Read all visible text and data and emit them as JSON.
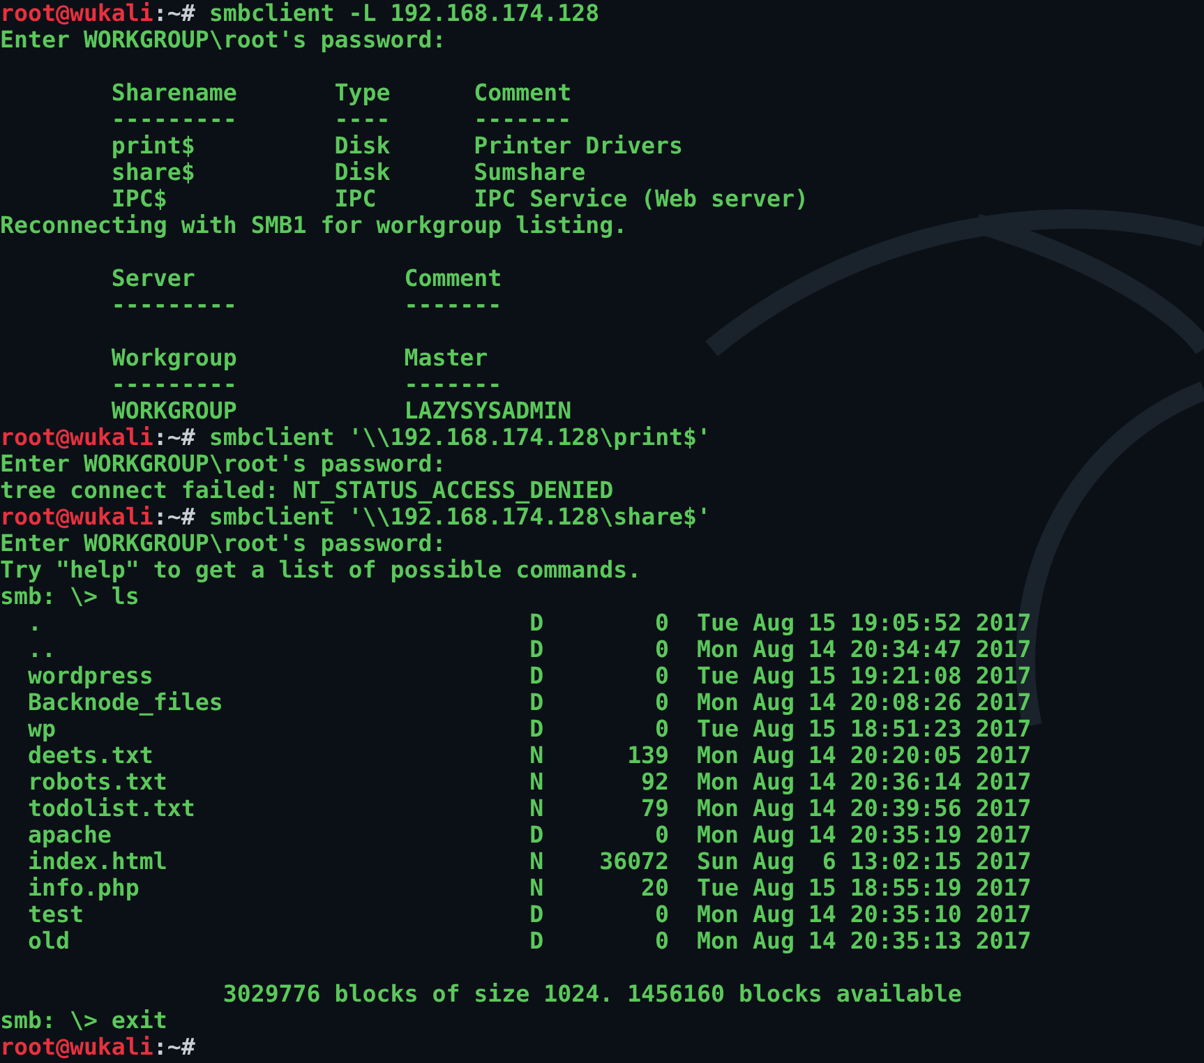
{
  "terminal": {
    "lines": [
      {
        "kind": "prompt",
        "user_host": "root@wukali",
        "path": ":~#",
        "command": "smbclient -L 192.168.174.128"
      },
      {
        "kind": "output",
        "text": "Enter WORKGROUP\\root's password:"
      },
      {
        "kind": "blank"
      },
      {
        "kind": "output",
        "text": "        Sharename       Type      Comment"
      },
      {
        "kind": "output",
        "text": "        ---------       ----      -------"
      },
      {
        "kind": "output",
        "text": "        print$          Disk      Printer Drivers"
      },
      {
        "kind": "output",
        "text": "        share$          Disk      Sumshare"
      },
      {
        "kind": "output",
        "text": "        IPC$            IPC       IPC Service (Web server)"
      },
      {
        "kind": "output",
        "text": "Reconnecting with SMB1 for workgroup listing."
      },
      {
        "kind": "blank"
      },
      {
        "kind": "output",
        "text": "        Server               Comment"
      },
      {
        "kind": "output",
        "text": "        ---------            -------"
      },
      {
        "kind": "blank"
      },
      {
        "kind": "output",
        "text": "        Workgroup            Master"
      },
      {
        "kind": "output",
        "text": "        ---------            -------"
      },
      {
        "kind": "output",
        "text": "        WORKGROUP            LAZYSYSADMIN"
      },
      {
        "kind": "prompt",
        "user_host": "root@wukali",
        "path": ":~#",
        "command": "smbclient '\\\\192.168.174.128\\print$'"
      },
      {
        "kind": "output",
        "text": "Enter WORKGROUP\\root's password:"
      },
      {
        "kind": "output",
        "text": "tree connect failed: NT_STATUS_ACCESS_DENIED"
      },
      {
        "kind": "prompt",
        "user_host": "root@wukali",
        "path": ":~#",
        "command": "smbclient '\\\\192.168.174.128\\share$'"
      },
      {
        "kind": "output",
        "text": "Enter WORKGROUP\\root's password:"
      },
      {
        "kind": "output",
        "text": "Try \"help\" to get a list of possible commands."
      },
      {
        "kind": "output",
        "text": "smb: \\> ls"
      },
      {
        "kind": "output",
        "text": "  .                                   D        0  Tue Aug 15 19:05:52 2017"
      },
      {
        "kind": "output",
        "text": "  ..                                  D        0  Mon Aug 14 20:34:47 2017"
      },
      {
        "kind": "output",
        "text": "  wordpress                           D        0  Tue Aug 15 19:21:08 2017"
      },
      {
        "kind": "output",
        "text": "  Backnode_files                      D        0  Mon Aug 14 20:08:26 2017"
      },
      {
        "kind": "output",
        "text": "  wp                                  D        0  Tue Aug 15 18:51:23 2017"
      },
      {
        "kind": "output",
        "text": "  deets.txt                           N      139  Mon Aug 14 20:20:05 2017"
      },
      {
        "kind": "output",
        "text": "  robots.txt                          N       92  Mon Aug 14 20:36:14 2017"
      },
      {
        "kind": "output",
        "text": "  todolist.txt                        N       79  Mon Aug 14 20:39:56 2017"
      },
      {
        "kind": "output",
        "text": "  apache                              D        0  Mon Aug 14 20:35:19 2017"
      },
      {
        "kind": "output",
        "text": "  index.html                          N    36072  Sun Aug  6 13:02:15 2017"
      },
      {
        "kind": "output",
        "text": "  info.php                            N       20  Tue Aug 15 18:55:19 2017"
      },
      {
        "kind": "output",
        "text": "  test                                D        0  Mon Aug 14 20:35:10 2017"
      },
      {
        "kind": "output",
        "text": "  old                                 D        0  Mon Aug 14 20:35:13 2017"
      },
      {
        "kind": "blank"
      },
      {
        "kind": "output",
        "text": "                3029776 blocks of size 1024. 1456160 blocks available"
      },
      {
        "kind": "output",
        "text": "smb: \\> exit"
      },
      {
        "kind": "prompt",
        "user_host": "root@wukali",
        "path": ":~#"
      }
    ]
  }
}
